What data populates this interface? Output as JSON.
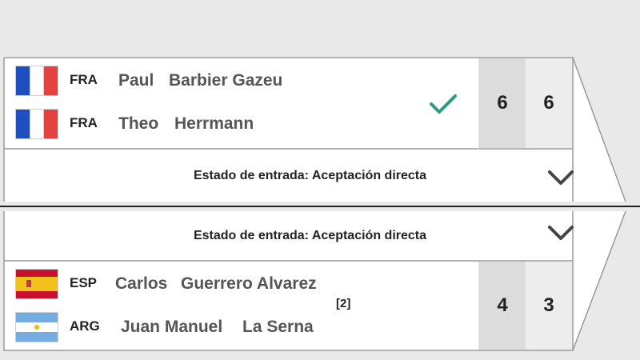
{
  "match_top": {
    "team": [
      {
        "country": "FRA",
        "first": "Paul",
        "last": "Barbier Gazeu",
        "flag_icon": "france-flag-icon"
      },
      {
        "country": "FRA",
        "first": "Theo",
        "last": "Herrmann",
        "flag_icon": "france-flag-icon"
      }
    ],
    "winner_icon": "checkmark-icon",
    "scores": [
      "6",
      "6"
    ],
    "entry_status": "Estado de entrada: Aceptación directa"
  },
  "match_bottom": {
    "entry_status": "Estado de entrada: Aceptación directa",
    "team": [
      {
        "country": "ESP",
        "first": "Carlos",
        "last": "Guerrero Alvarez",
        "flag_icon": "spain-flag-icon"
      },
      {
        "country": "ARG",
        "first": "Juan Manuel",
        "last": "La Serna",
        "flag_icon": "argentina-flag-icon"
      }
    ],
    "seed": "[2]",
    "scores": [
      "4",
      "3"
    ]
  },
  "colors": {
    "check": "#2e9a7e",
    "score_bg": "#dcdcdc",
    "card_bg": "#ffffff",
    "page_bg": "#e9e9e9"
  }
}
